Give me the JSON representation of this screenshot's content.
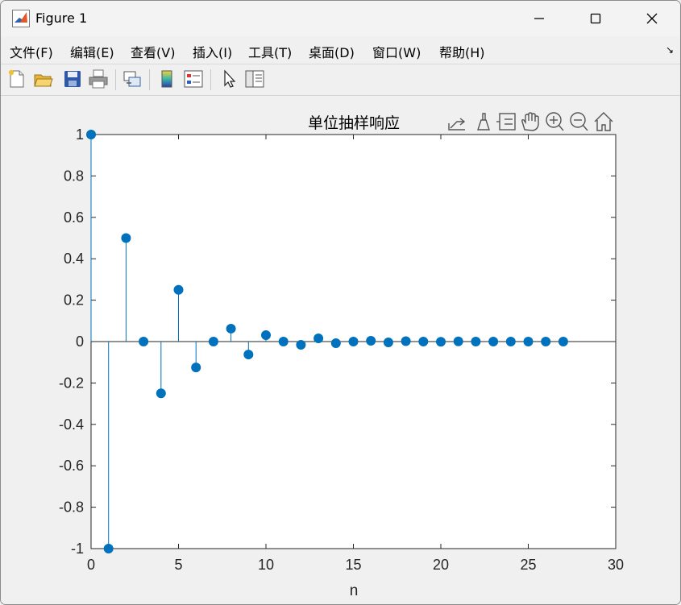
{
  "window": {
    "title": "Figure 1"
  },
  "menu": {
    "items": [
      "文件(F)",
      "编辑(E)",
      "查看(V)",
      "插入(I)",
      "工具(T)",
      "桌面(D)",
      "窗口(W)",
      "帮助(H)"
    ]
  },
  "toolbar": {
    "buttons": [
      "new-figure-icon",
      "open-file-icon",
      "save-icon",
      "print-icon",
      "link-plot-icon",
      "colorbar-icon",
      "legend-icon",
      "edit-plot-arrow-icon",
      "property-inspector-icon"
    ]
  },
  "axes_toolbar": {
    "buttons": [
      "export-icon",
      "brush-icon",
      "datatip-icon",
      "pan-hand-icon",
      "zoom-in-icon",
      "zoom-out-icon",
      "home-icon"
    ]
  },
  "colors": {
    "stem": "#0072bd",
    "axis": "#262626",
    "background": "#f0f0f0"
  },
  "chart_data": {
    "type": "stem",
    "title": "单位抽样响应",
    "xlabel": "n",
    "ylabel": "",
    "xlim": [
      0,
      30
    ],
    "ylim": [
      -1,
      1
    ],
    "xticks": [
      0,
      5,
      10,
      15,
      20,
      25,
      30
    ],
    "yticks": [
      -1,
      -0.8,
      -0.6,
      -0.4,
      -0.2,
      0,
      0.2,
      0.4,
      0.6,
      0.8,
      1
    ],
    "grid": false,
    "series": [
      {
        "x": [
          0,
          1,
          2,
          3,
          4,
          5,
          6,
          7,
          8,
          9,
          10,
          11,
          12,
          13,
          14,
          15,
          16,
          17,
          18,
          19,
          20,
          21,
          22,
          23,
          24,
          25,
          26,
          27
        ],
        "values": [
          1,
          -1,
          0.5,
          0,
          -0.25,
          0.25,
          -0.125,
          0,
          0.0625,
          -0.0625,
          0.03125,
          0,
          -0.015625,
          0.015625,
          -0.0078,
          0,
          0.0039,
          -0.0039,
          0.002,
          0,
          -0.001,
          0.001,
          0,
          0,
          0,
          0,
          0,
          0
        ]
      }
    ]
  }
}
